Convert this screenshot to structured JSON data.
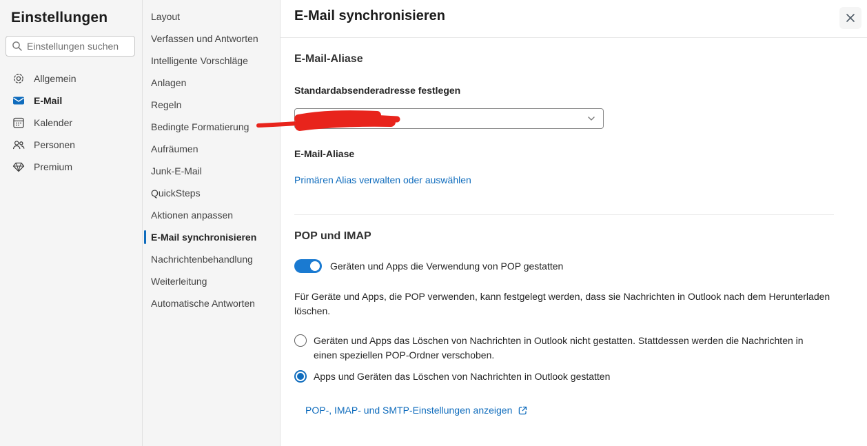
{
  "colors": {
    "accent": "#0f6cbd",
    "redaction": "#e8241c",
    "panel_bg": "#f5f5f5"
  },
  "sidebar": {
    "title": "Einstellungen",
    "search_placeholder": "Einstellungen suchen",
    "items": [
      {
        "label": "Allgemein",
        "icon": "gear-icon",
        "selected": false
      },
      {
        "label": "E-Mail",
        "icon": "mail-icon",
        "selected": true
      },
      {
        "label": "Kalender",
        "icon": "calendar-icon",
        "selected": false
      },
      {
        "label": "Personen",
        "icon": "people-icon",
        "selected": false
      },
      {
        "label": "Premium",
        "icon": "diamond-icon",
        "selected": false
      }
    ]
  },
  "subnav": {
    "items": [
      {
        "label": "Layout",
        "selected": false
      },
      {
        "label": "Verfassen und Antworten",
        "selected": false
      },
      {
        "label": "Intelligente Vorschläge",
        "selected": false
      },
      {
        "label": "Anlagen",
        "selected": false
      },
      {
        "label": "Regeln",
        "selected": false
      },
      {
        "label": "Bedingte Formatierung",
        "selected": false
      },
      {
        "label": "Aufräumen",
        "selected": false
      },
      {
        "label": "Junk-E-Mail",
        "selected": false
      },
      {
        "label": "QuickSteps",
        "selected": false
      },
      {
        "label": "Aktionen anpassen",
        "selected": false
      },
      {
        "label": "E-Mail synchronisieren",
        "selected": true
      },
      {
        "label": "Nachrichtenbehandlung",
        "selected": false
      },
      {
        "label": "Weiterleitung",
        "selected": false
      },
      {
        "label": "Automatische Antworten",
        "selected": false
      }
    ]
  },
  "main": {
    "title": "E-Mail synchronisieren",
    "aliases_section": {
      "heading": "E-Mail-Aliase",
      "default_sender_label": "Standardabsenderadresse festlegen",
      "dropdown_value": "",
      "dropdown_redacted": true,
      "aliases_label": "E-Mail-Aliase",
      "manage_alias_link": "Primären Alias verwalten oder auswählen"
    },
    "pop_imap_section": {
      "heading": "POP und IMAP",
      "toggle_label": "Geräten und Apps die Verwendung von POP gestatten",
      "toggle_state": "on",
      "description": "Für Geräte und Apps, die POP verwenden, kann festgelegt werden, dass sie Nachrichten in Outlook nach dem Herunterladen löschen.",
      "radio_options": [
        {
          "label": "Geräten und Apps das Löschen von Nachrichten in Outlook nicht gestatten. Stattdessen werden die Nachrichten in einen speziellen POP-Ordner verschoben.",
          "selected": false
        },
        {
          "label": "Apps und Geräten das Löschen von Nachrichten in Outlook gestatten",
          "selected": true
        }
      ],
      "settings_link": "POP-, IMAP- und SMTP-Einstellungen anzeigen"
    }
  }
}
